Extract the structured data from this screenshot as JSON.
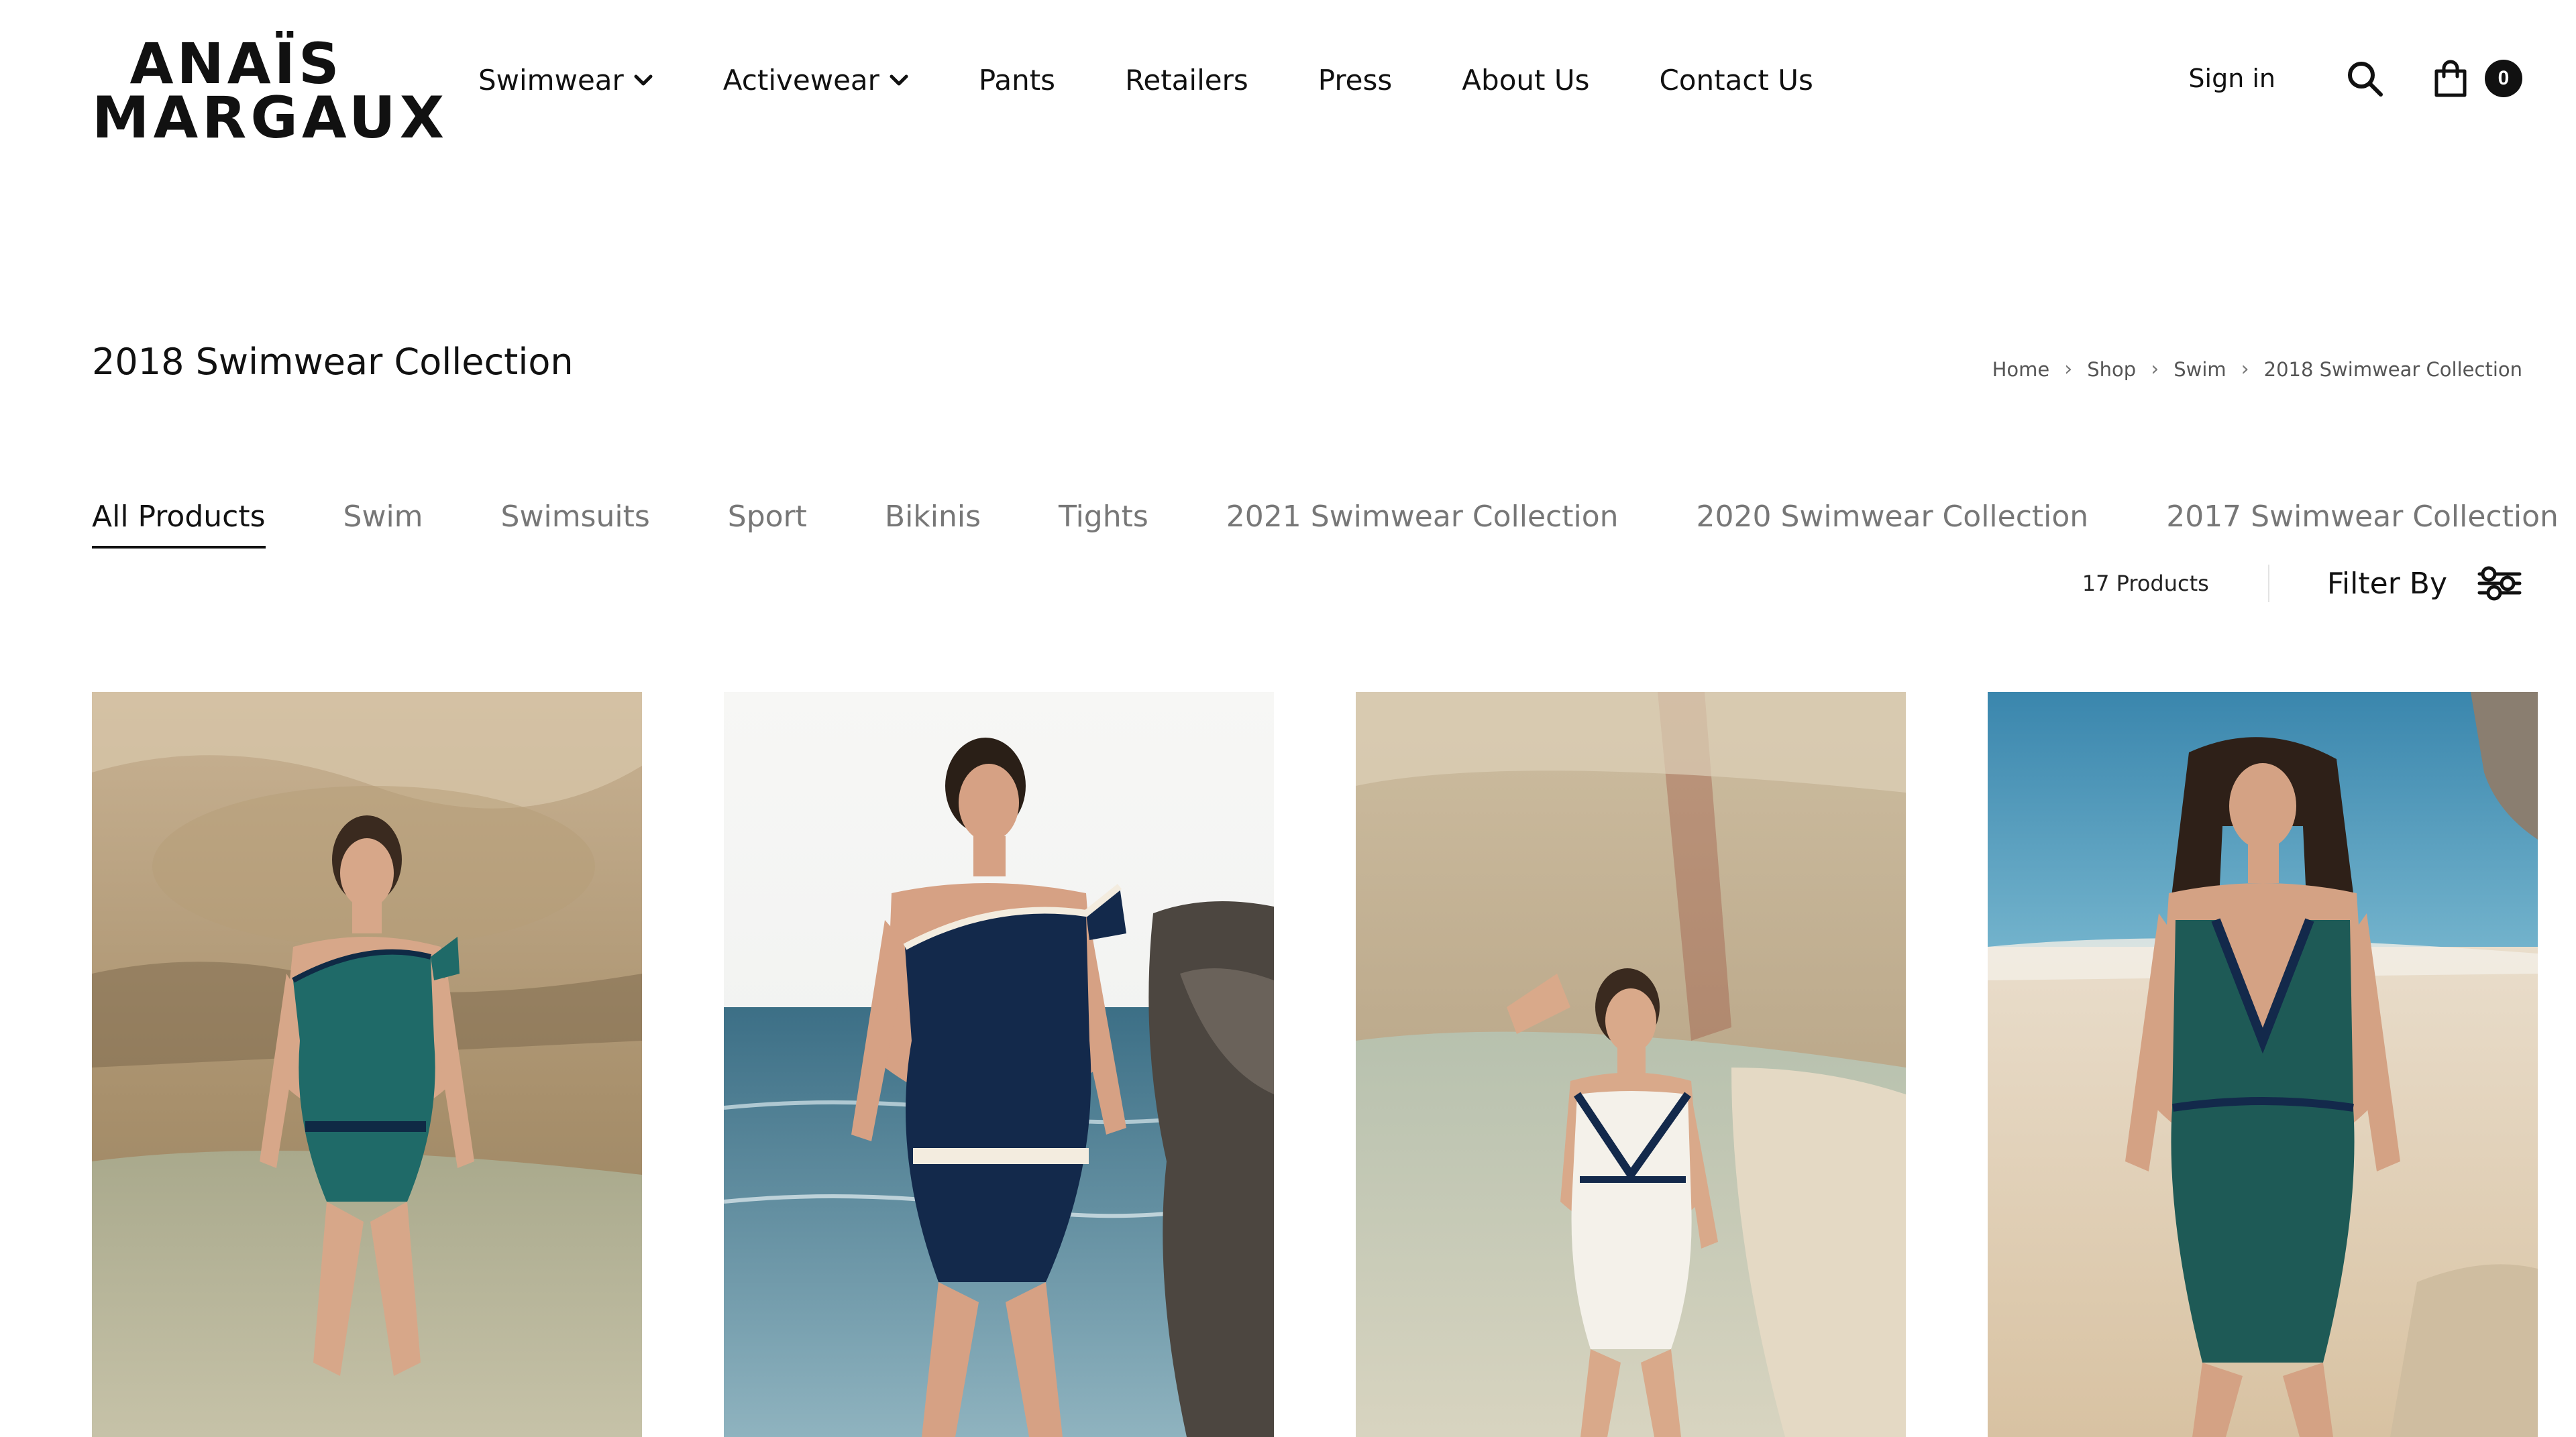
{
  "brand": {
    "line1": "ANAÏS",
    "line2": "MARGAUX"
  },
  "nav": [
    {
      "label": "Swimwear",
      "dropdown": true
    },
    {
      "label": "Activewear",
      "dropdown": true
    },
    {
      "label": "Pants",
      "dropdown": false
    },
    {
      "label": "Retailers",
      "dropdown": false
    },
    {
      "label": "Press",
      "dropdown": false
    },
    {
      "label": "About Us",
      "dropdown": false
    },
    {
      "label": "Contact Us",
      "dropdown": false
    }
  ],
  "header": {
    "signin": "Sign in",
    "cart_count": "0",
    "search_icon": "search-icon",
    "cart_icon": "shopping-bag-icon"
  },
  "page": {
    "title": "2018 Swimwear Collection"
  },
  "breadcrumb": [
    "Home",
    "Shop",
    "Swim",
    "2018 Swimwear Collection"
  ],
  "tabs": [
    {
      "label": "All Products",
      "active": true
    },
    {
      "label": "Swim"
    },
    {
      "label": "Swimsuits"
    },
    {
      "label": "Sport"
    },
    {
      "label": "Bikinis"
    },
    {
      "label": "Tights"
    },
    {
      "label": "2021 Swimwear Collection"
    },
    {
      "label": "2020 Swimwear Collection"
    },
    {
      "label": "2017 Swimwear Collection"
    }
  ],
  "toolbar": {
    "count": "17 Products",
    "filter_label": "Filter By",
    "filter_icon": "sliders-icon"
  },
  "products": [
    {
      "suit_color": "#1f6a68",
      "accent": "#0f2a45",
      "bg": "rocks"
    },
    {
      "suit_color": "#13294b",
      "accent": "#f3ecdf",
      "bg": "sea"
    },
    {
      "suit_color": "#f4f1ea",
      "accent": "#13294b",
      "bg": "cliff"
    },
    {
      "suit_color": "#1e5a56",
      "accent": "#13294b",
      "bg": "beach"
    }
  ]
}
